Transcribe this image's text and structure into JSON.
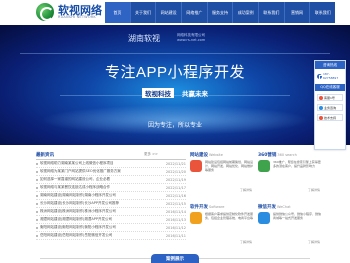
{
  "header": {
    "brand": "软视网络",
    "brand_sub": "RUANSHI NETWORK"
  },
  "nav": {
    "items": [
      "首页",
      "关于我们",
      "网站建设",
      "网络推广",
      "服务支持",
      "成功案例",
      "联系我们",
      "营销网",
      "联系我们"
    ]
  },
  "banner": {
    "company": "湖南软视",
    "company_en": "网络科技有限公司",
    "company_sub": "www.rs-net.com",
    "title": "专注APP小程序开发",
    "slogan_box": "软视科技",
    "slogan": "共赢未来",
    "tagline": "因为专注，所以专业"
  },
  "contact": {
    "head": "咨询热线",
    "phone": "187-62758897",
    "sub": "QQ在线客服",
    "qq": [
      "客服1号",
      "业务咨询",
      "技术支持"
    ]
  },
  "news": {
    "title": "最新资讯",
    "more": "更多 >>",
    "items": [
      {
        "text": "软视网络助力湖南某某公司上线微信小程序项目",
        "date": "2022/11/21"
      },
      {
        "text": "软视网络为某某门户网站提供SEO优化推广服务方案",
        "date": "2022/11/20"
      },
      {
        "text": "如何选择一家靠谱的网站建设公司，企业必看",
        "date": "2022/11/19"
      },
      {
        "text": "软视网络与某某餐饮连锁达成小程序战略合作",
        "date": "2022/11/17"
      },
      {
        "text": "湖南网站建设|湖南网站制作|湖南小程序开发公司",
        "date": "2022/11/16"
      },
      {
        "text": "长沙网站建设|长沙网站制作|长沙APP开发公司推荐",
        "date": "2022/11/15"
      },
      {
        "text": "株洲网站建设|株洲网站制作|株洲小程序开发公司",
        "date": "2016/11/14"
      },
      {
        "text": "湘潭网站建设|湘潭网站制作|湘潭APP开发公司",
        "date": "2016/11/13"
      },
      {
        "text": "衡阳网站建设|衡阳网站制作|衡阳小程序开发公司",
        "date": "2016/11/12"
      },
      {
        "text": "岳阳网站建设|岳阳网站制作|岳阳微信开发公司",
        "date": "2016/11/11"
      }
    ]
  },
  "services": [
    {
      "title": "网站建设",
      "en": "Website",
      "desc": "网站建设包括网站前期策划、网站设计、网站开发、网站优化、网站维护等服务",
      "more": "了解详情",
      "color": "#e9543b"
    },
    {
      "title": "360营销",
      "en": "360 search",
      "desc": "360推广，帮您在搜索引擎上获得更多的潜在客户，提升品牌影响力",
      "more": "了解详情",
      "color": "#3fa34d"
    },
    {
      "title": "软件开发",
      "en": "Software",
      "desc": "根据客户需求提供定制化软件开发服务，包括企业管理系统、电商平台等",
      "more": "了解详情",
      "color": "#f0a21f"
    },
    {
      "title": "微信开发",
      "en": "WeChat",
      "desc": "提供微信公众号、微信小程序、微信商城等一站式开发服务",
      "more": "了解详情",
      "color": "#2b8de0"
    }
  ],
  "case_tab": "案例展示",
  "colors": {
    "nav": "#1f4ea5",
    "accent": "#2b62c4"
  }
}
